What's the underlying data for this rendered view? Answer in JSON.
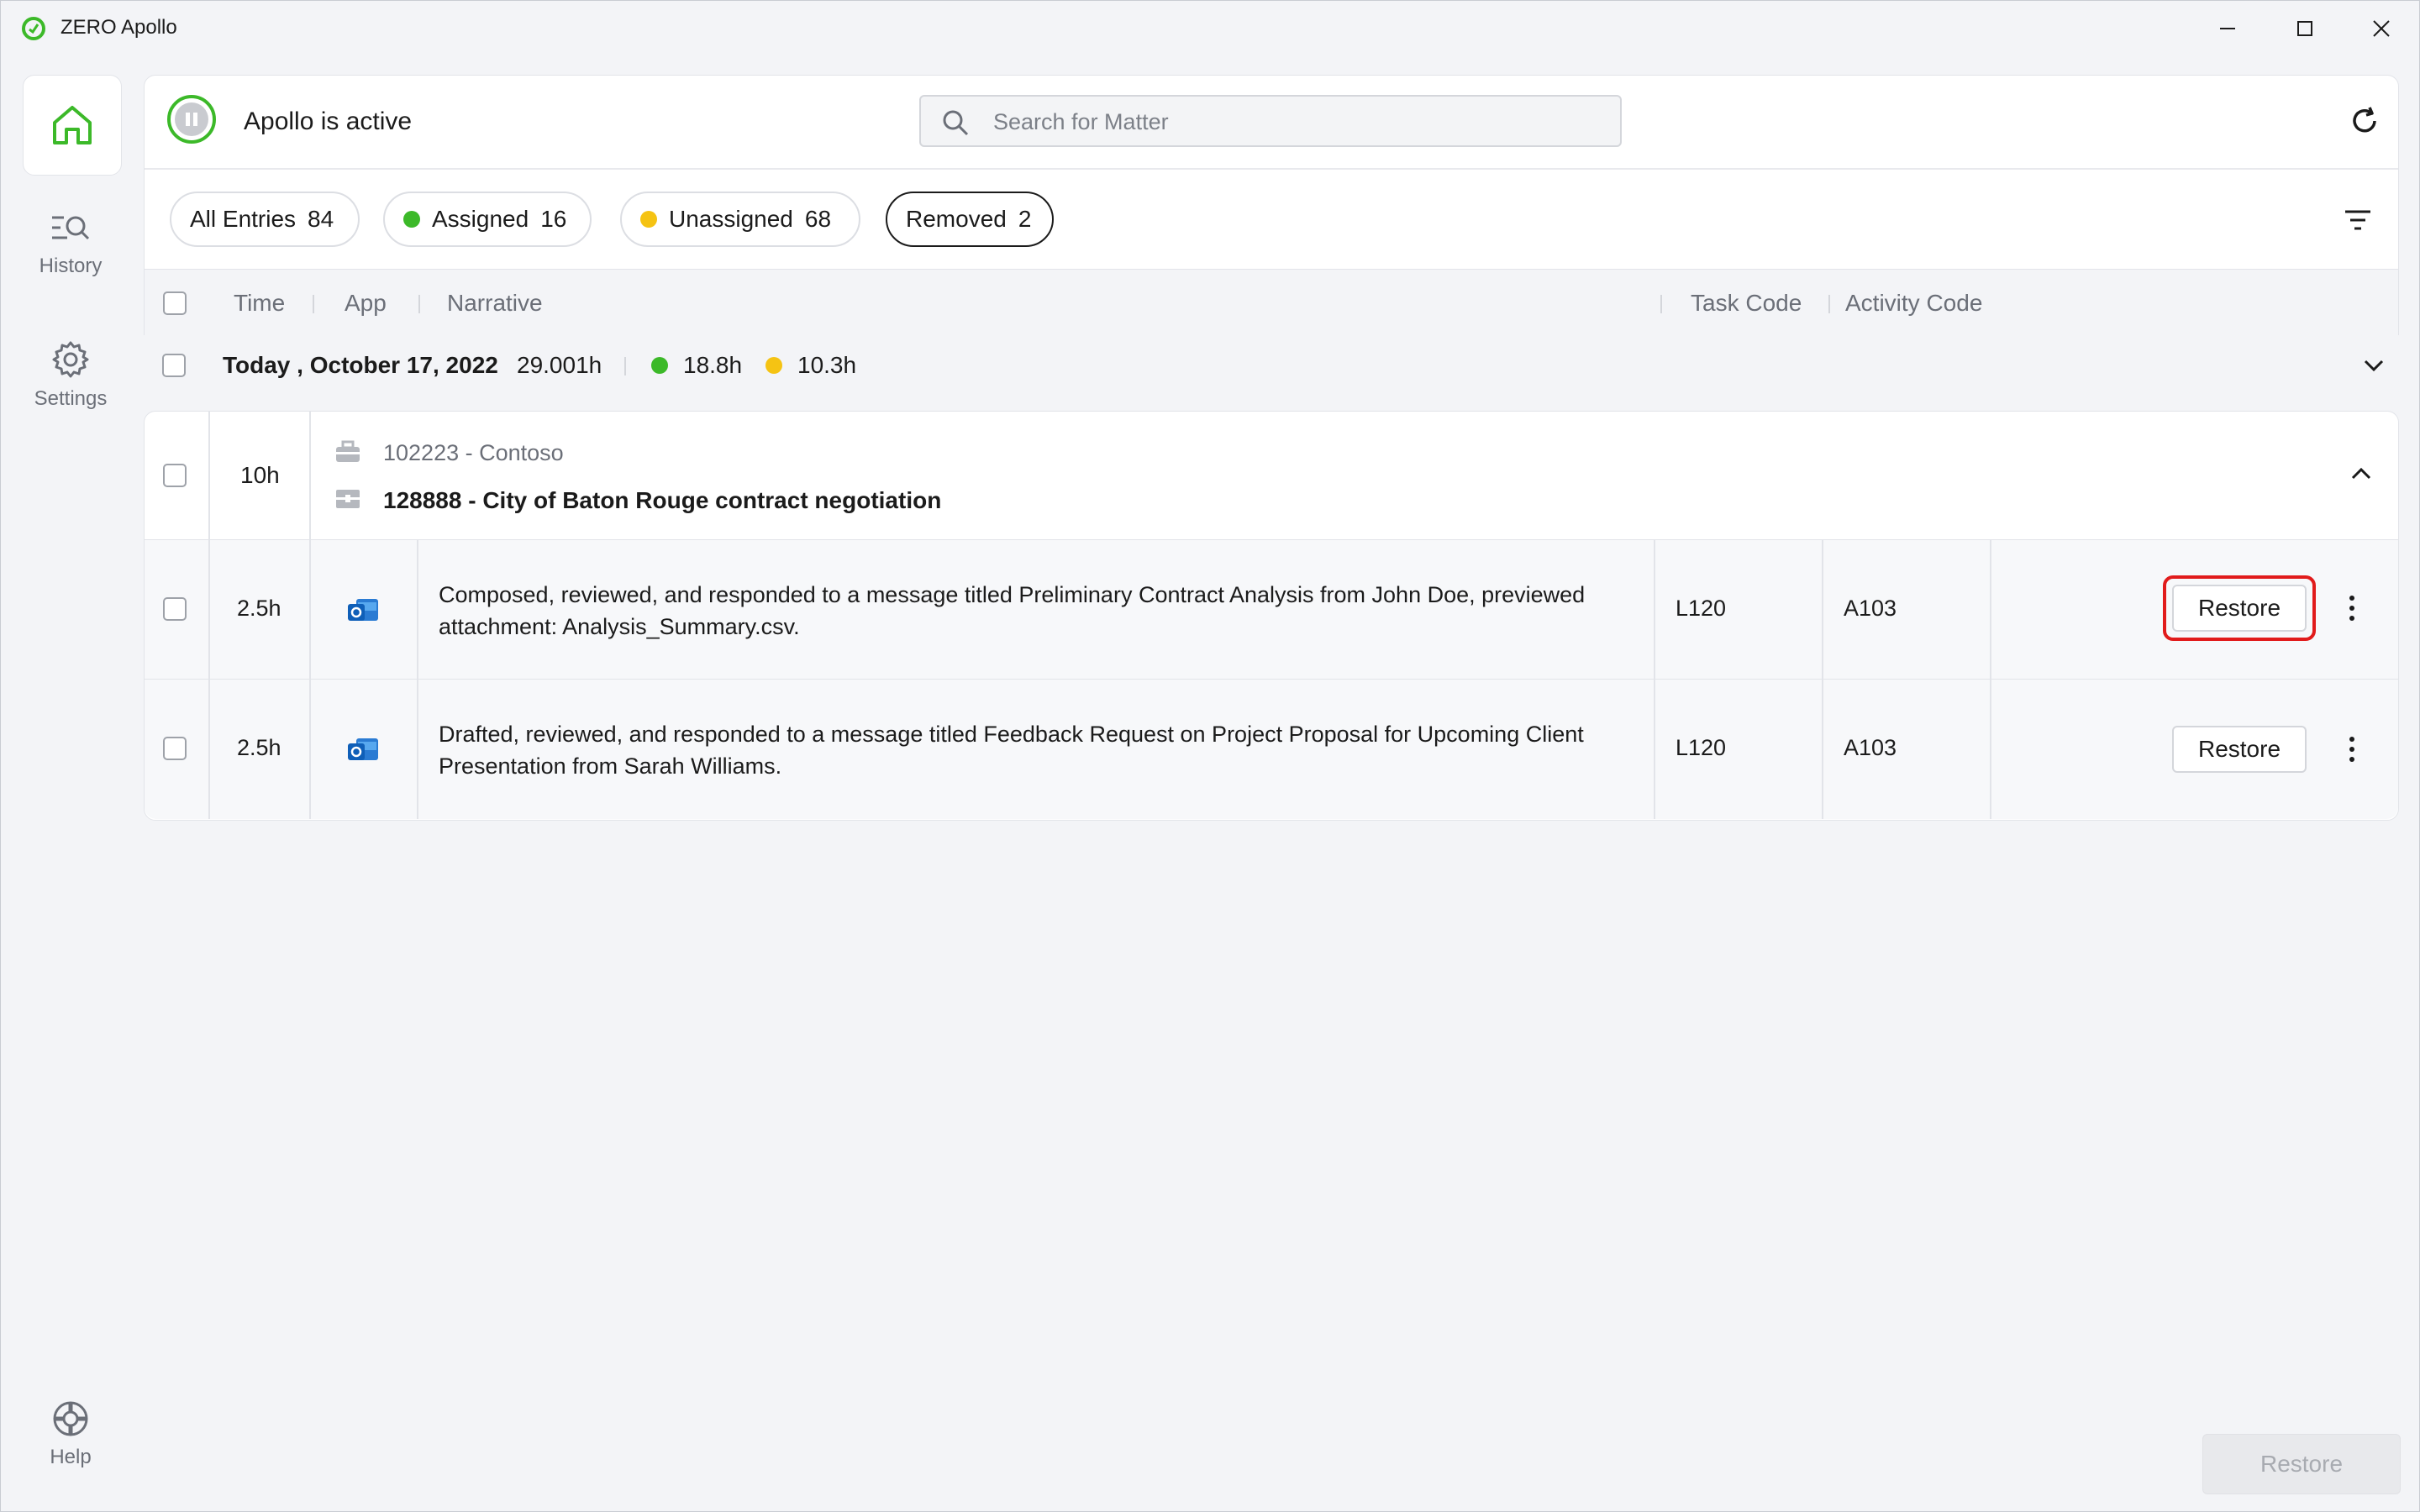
{
  "window": {
    "title": "ZERO Apollo",
    "minimize_icon": "minimize-icon",
    "maximize_icon": "maximize-icon",
    "close_icon": "close-icon"
  },
  "sidebar": {
    "items": [
      {
        "label": "",
        "icon": "home-icon",
        "active": true
      },
      {
        "label": "History",
        "icon": "history-search-icon"
      },
      {
        "label": "Settings",
        "icon": "gear-icon"
      }
    ],
    "help": {
      "label": "Help",
      "icon": "lifebuoy-icon"
    }
  },
  "header": {
    "status_text": "Apollo is active",
    "status_icon": "pause-icon",
    "search_placeholder": "Search for Matter",
    "refresh_icon": "refresh-icon",
    "filter_icon": "filter-icon"
  },
  "filters": {
    "all": {
      "label": "All Entries",
      "count": "84"
    },
    "assigned": {
      "label": "Assigned",
      "count": "16",
      "color": "#3cb929"
    },
    "unassigned": {
      "label": "Unassigned",
      "count": "68",
      "color": "#f5c313"
    },
    "removed": {
      "label": "Removed",
      "count": "2",
      "selected": true
    }
  },
  "columns": {
    "time": "Time",
    "app": "App",
    "narrative": "Narrative",
    "task_code": "Task Code",
    "activity_code": "Activity Code"
  },
  "date_group": {
    "label": "Today , October 17, 2022",
    "total": "29.001h",
    "assigned": "18.8h",
    "unassigned": "10.3h"
  },
  "matter": {
    "time": "10h",
    "client": "102223 - Contoso",
    "matter": "128888 - City of Baton Rouge contract negotiation",
    "entries": [
      {
        "time": "2.5h",
        "app_icon": "outlook-icon",
        "narrative": "Composed, reviewed, and responded to a message titled Preliminary Contract Analysis from John Doe, previewed attachment: Analysis_Summary.csv.",
        "task_code": "L120",
        "activity_code": "A103",
        "action": "Restore"
      },
      {
        "time": "2.5h",
        "app_icon": "outlook-icon",
        "narrative": "Drafted, reviewed, and responded to a message titled Feedback Request on Project Proposal for Upcoming Client Presentation from Sarah Williams.",
        "task_code": "L120",
        "activity_code": "A103",
        "action": "Restore"
      }
    ]
  },
  "footer": {
    "restore_label": "Restore"
  },
  "colors": {
    "accent_green": "#3cb929",
    "accent_yellow": "#f5c313",
    "highlight_red": "#e11b1b"
  }
}
